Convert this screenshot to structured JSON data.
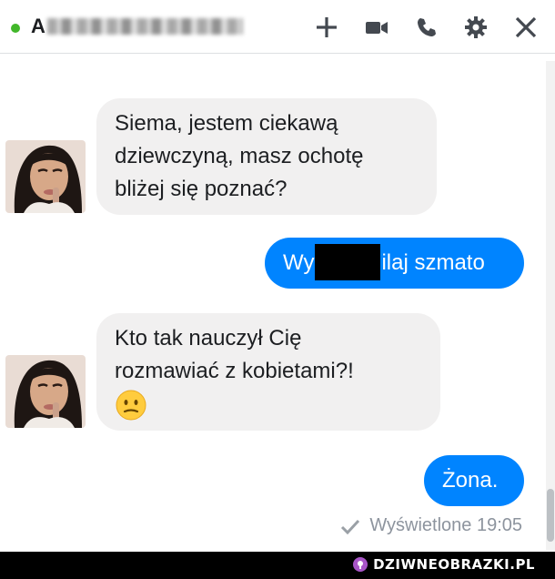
{
  "header": {
    "contact_initial": "A",
    "icons": [
      "plus-icon",
      "video-camera-icon",
      "phone-icon",
      "gear-icon",
      "close-icon"
    ]
  },
  "messages": [
    {
      "from": "contact",
      "lines": [
        "Siema, jestem ciekawą",
        "dziewczyną, masz ochotę",
        "bliżej się poznać?"
      ]
    },
    {
      "from": "me",
      "text_before": "Wy",
      "text_after": "ilaj szmato"
    },
    {
      "from": "contact",
      "lines": [
        "Kto tak nauczył Cię",
        "rozmawiać z kobietami?!"
      ],
      "emoji": "confused-face-icon"
    },
    {
      "from": "me",
      "text": "Żona."
    }
  ],
  "seen_status": "Wyświetlone 19:05",
  "watermark": "DZIWNEOBRAZKI.PL",
  "colors": {
    "presence": "#42b72a",
    "outgoing_bubble": "#0084ff",
    "incoming_bubble": "#f1f0f0",
    "icon": "#444950"
  }
}
